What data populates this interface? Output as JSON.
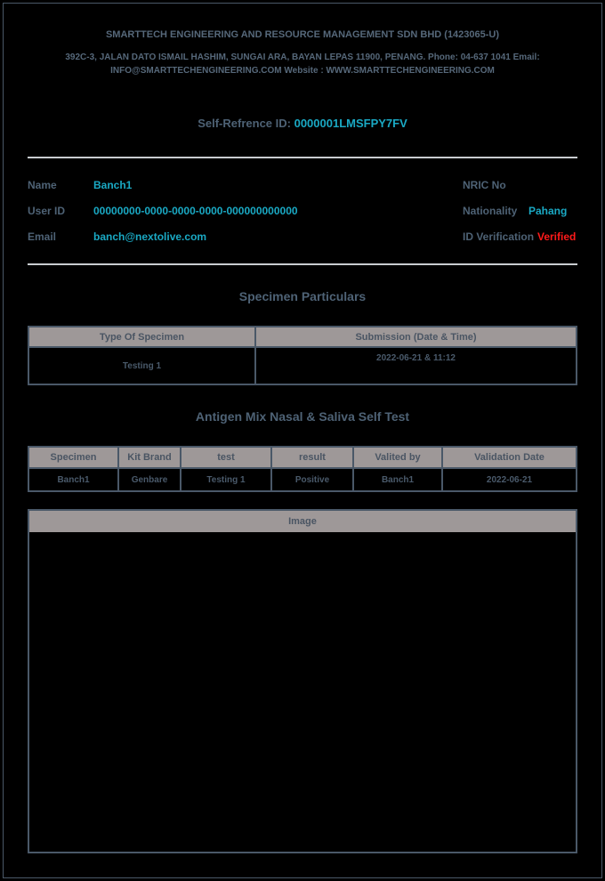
{
  "header": {
    "company": "SMARTTECH ENGINEERING AND RESOURCE MANAGEMENT SDN BHD (1423065-U)",
    "address_line1": "392C-3, JALAN DATO ISMAIL HASHIM, SUNGAI ARA, BAYAN LEPAS 11900, PENANG. Phone: 04-637 1041 Email:",
    "address_line2": "INFO@SMARTTECHENGINEERING.COM Website : WWW.SMARTTECHENGINEERING.COM",
    "ref_label": "Self-Refrence ID:",
    "ref_value": "0000001LMSFPY7FV"
  },
  "person": {
    "name_label": "Name",
    "name_value": "Banch1",
    "userid_label": "User ID",
    "userid_value": "00000000-0000-0000-0000-000000000000",
    "email_label": "Email",
    "email_value": "banch@nextolive.com",
    "nric_label": "NRIC No",
    "nric_value": "",
    "nationality_label": "Nationality",
    "nationality_value": "Pahang",
    "idver_label": "ID Verification",
    "idver_value": "Verified"
  },
  "specimen": {
    "title": "Specimen Particulars",
    "headers": [
      "Type Of Specimen",
      "Submission (Date & Time)"
    ],
    "row": [
      "Testing 1",
      "2022-06-21 & 11:12"
    ]
  },
  "antigen": {
    "title": "Antigen Mix Nasal & Saliva Self Test",
    "headers": [
      "Specimen",
      "Kit Brand",
      "test",
      "result",
      "Valited by",
      "Validation Date"
    ],
    "row": [
      "Banch1",
      "Genbare",
      "Testing 1",
      "Positive",
      "Banch1",
      "2022-06-21"
    ]
  },
  "image": {
    "header": "Image"
  },
  "colors": {
    "label": "#4e6275",
    "value": "#1aa9c4",
    "verified": "#ff1a1a",
    "table_header_bg": "#9e9898",
    "border": "#4a5868"
  }
}
